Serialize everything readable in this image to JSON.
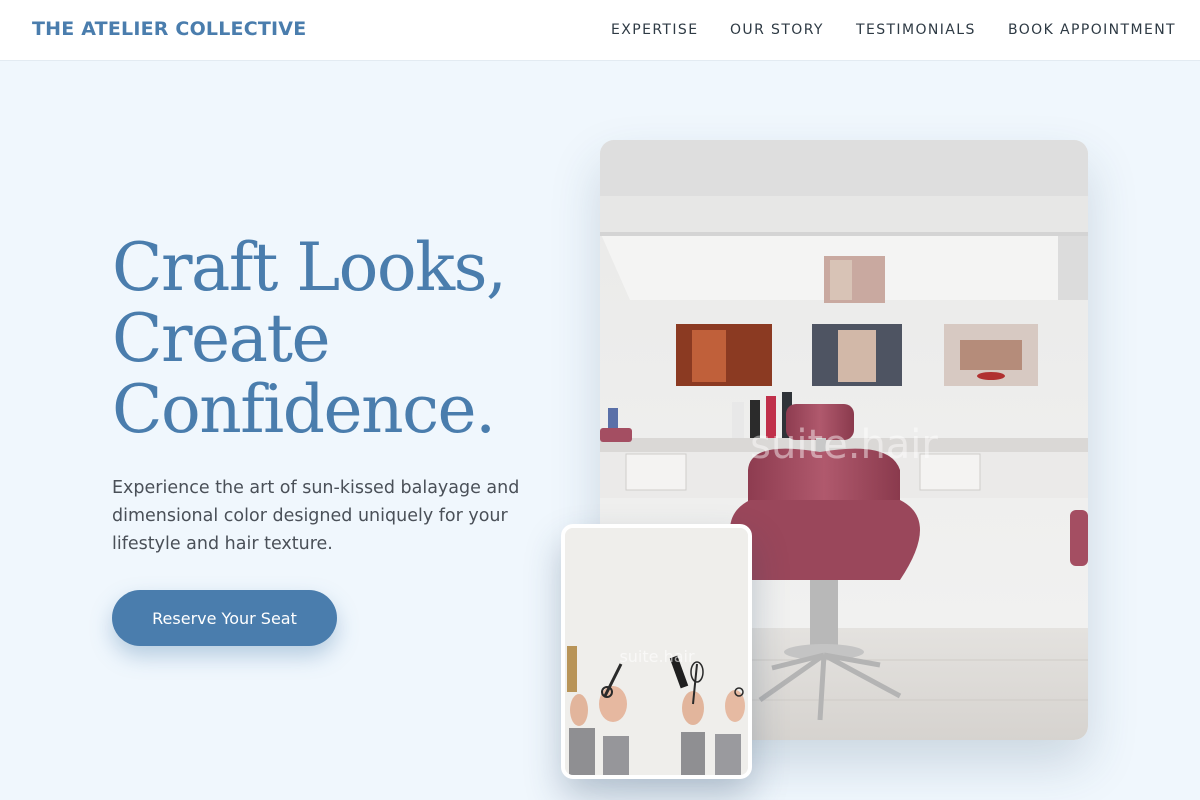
{
  "brand": "THE ATELIER COLLECTIVE",
  "nav": {
    "items": [
      "EXPERTISE",
      "OUR STORY",
      "TESTIMONIALS",
      "BOOK APPOINTMENT"
    ]
  },
  "hero": {
    "title_lines": [
      "Craft Looks,",
      "Create",
      "Confidence."
    ],
    "description": "Experience the art of sun-kissed balayage and dimensional color designed uniquely for your lifestyle and hair texture.",
    "cta_label": "Reserve Your Seat"
  },
  "photos": {
    "main_watermark": "suite.hair",
    "small_watermark": "suite.hair"
  },
  "colors": {
    "accent": "#4a7dad",
    "background": "#f0f7fd",
    "chair": "#a44e62"
  }
}
